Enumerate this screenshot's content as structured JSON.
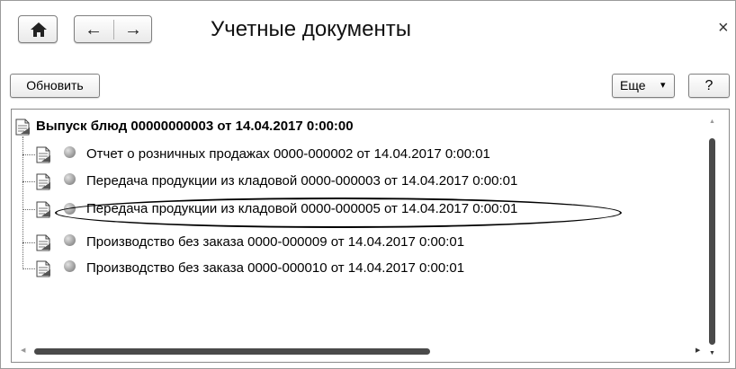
{
  "window": {
    "title": "Учетные документы",
    "close_glyph": "×"
  },
  "nav": {
    "home_glyph": "🏠",
    "back_glyph": "←",
    "forward_glyph": "→"
  },
  "toolbar": {
    "refresh_label": "Обновить",
    "more_label": "Еще",
    "more_caret": "▾",
    "help_label": "?"
  },
  "tree": {
    "root": {
      "label": "Выпуск блюд 00000000003 от 14.04.2017 0:00:00",
      "icon": "document-icon"
    },
    "children": [
      {
        "label": "Отчет о розничных продажах 0000-000002 от 14.04.2017 0:00:01",
        "icon": "document-icon",
        "status": "unposted"
      },
      {
        "label": "Передача продукции из кладовой 0000-000003 от 14.04.2017 0:00:01",
        "icon": "document-icon",
        "status": "unposted"
      },
      {
        "label": "Передача продукции из кладовой 0000-000005 от 14.04.2017 0:00:01",
        "icon": "document-icon",
        "status": "unposted",
        "highlighted": true
      },
      {
        "label": "Производство без заказа 0000-000009 от 14.04.2017 0:00:01",
        "icon": "document-icon",
        "status": "unposted"
      },
      {
        "label": "Производство без заказа 0000-000010 от 14.04.2017 0:00:01",
        "icon": "document-icon",
        "status": "unposted"
      }
    ]
  },
  "scrollbars": {
    "up_glyph": "▲",
    "down_glyph": "▼",
    "left_glyph": "◀",
    "right_glyph": "▶"
  }
}
